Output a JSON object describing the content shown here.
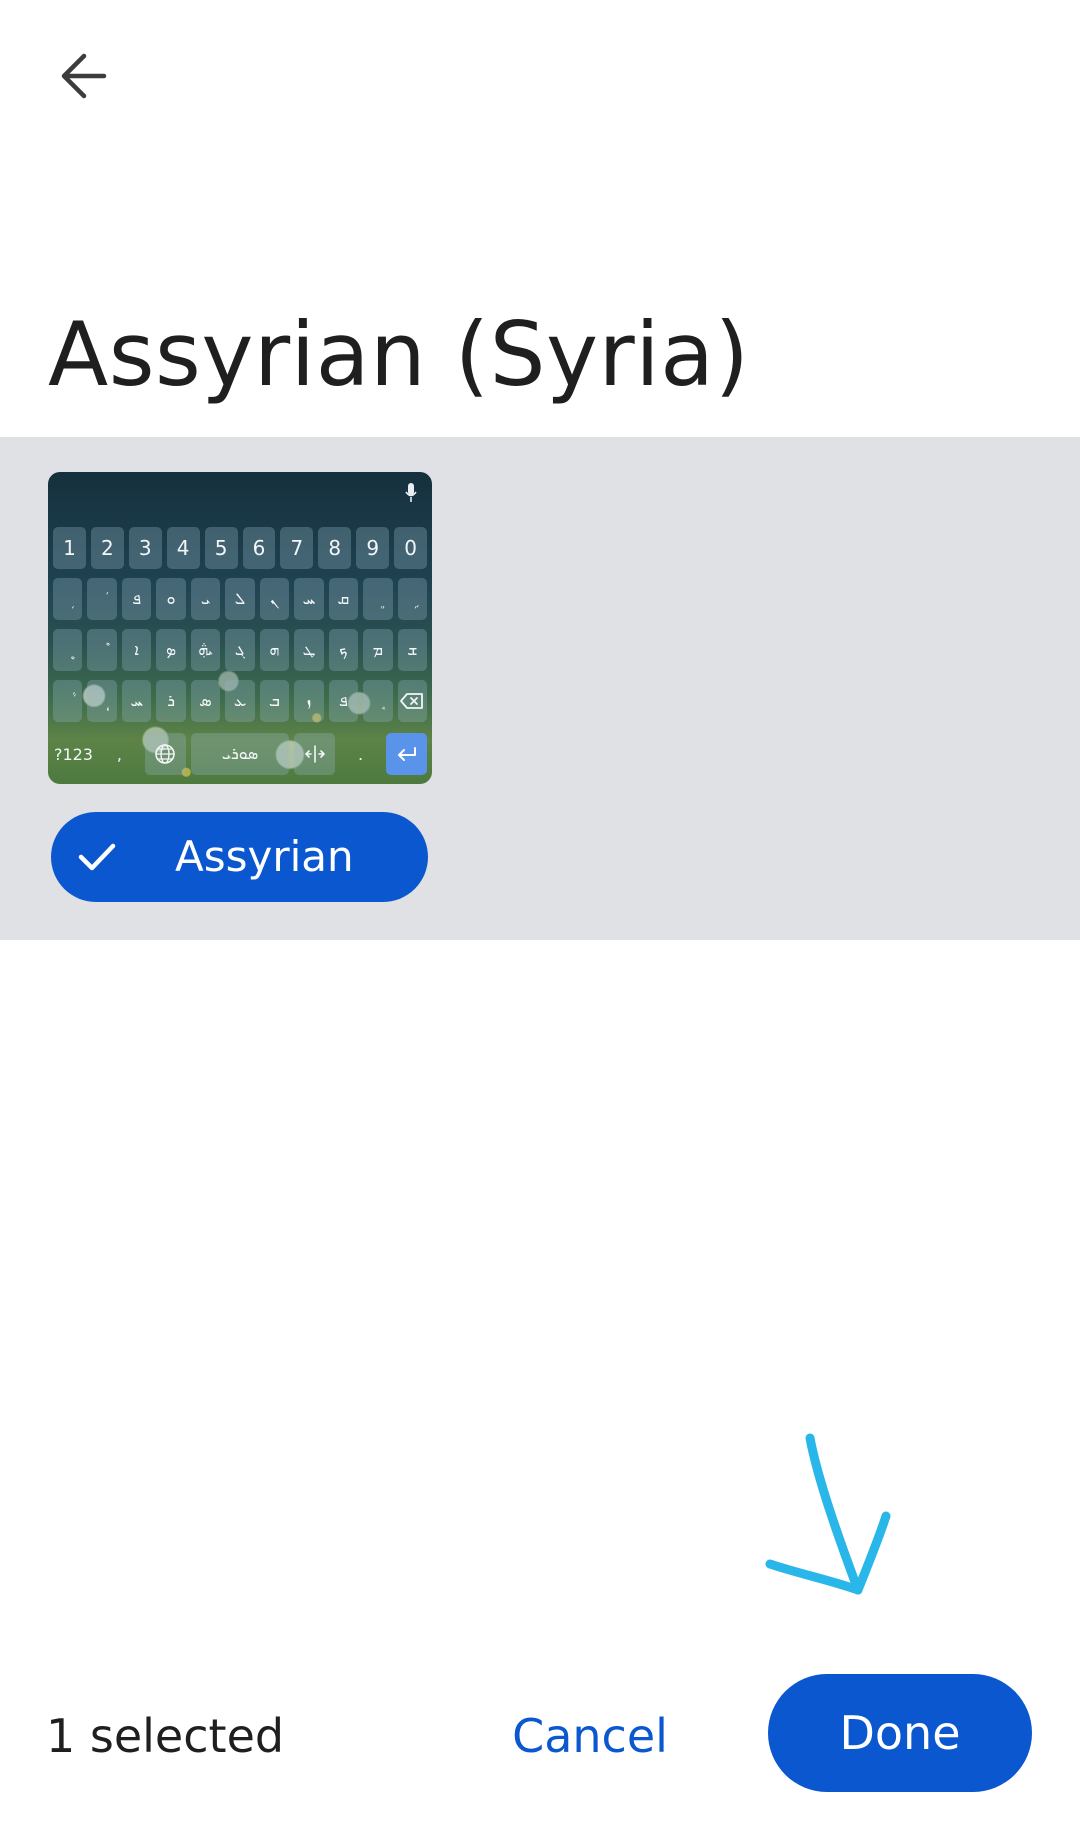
{
  "header": {
    "back_label": "Back",
    "title": "Assyrian (Syria)"
  },
  "keyboard_preview": {
    "row1": [
      "1",
      "2",
      "3",
      "4",
      "5",
      "6",
      "7",
      "8",
      "9",
      "0"
    ],
    "row2": [
      "ܼ",
      "ܿ",
      "ܦ",
      "ܘ",
      "ܝ",
      "ܠ",
      "ܢ",
      "ܚ",
      "ܩ",
      "ܸ",
      "ܹ"
    ],
    "row3": [
      "ܷ",
      "ܶ",
      "ܐ",
      "ܤ",
      "ܞ",
      "ܓ",
      "ܗ",
      "ܛ",
      "ܟ",
      "ܡ",
      "ܫ"
    ],
    "row4": [
      "ܵ",
      "ܴ",
      "ܚ",
      "ܪ",
      "ܣ",
      "ܥ",
      "ܒ",
      "ܙ",
      "ܦ",
      "ܱ"
    ],
    "row5": {
      "symbols": "?123",
      "comma": ",",
      "space": "ܣܘܪܝ",
      "period": "."
    }
  },
  "layout_chip": {
    "label": "Assyrian",
    "selected": true
  },
  "footer": {
    "selected_count": "1 selected",
    "cancel_label": "Cancel",
    "done_label": "Done"
  },
  "colors": {
    "primary": "#0b57d0",
    "panel": "#dfe1e5",
    "annotation": "#29b6e8"
  }
}
